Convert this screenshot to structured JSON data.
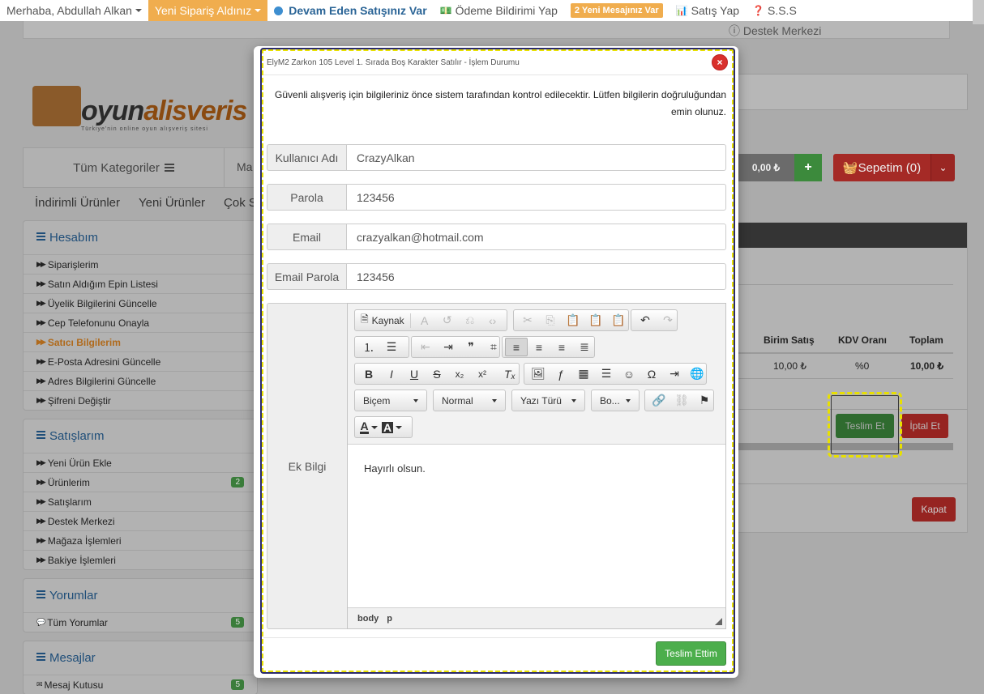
{
  "topbar": {
    "greeting": "Merhaba, Abdullah Alkan",
    "new_order": "Yeni Sipariş Aldınız",
    "ongoing_sale": "Devam Eden Satışınız Var",
    "payment_notice": "Ödeme Bildirimi Yap",
    "messages_badge": "2 Yeni Mesajınız Var",
    "sell": "Satış Yap",
    "faq": "S.S.S",
    "support": "Destek Merkezi"
  },
  "logo": {
    "text_a": "oyun",
    "text_b": "alisveris",
    "tagline": "Türkiye'nin online oyun alışveriş sitesi"
  },
  "nav": {
    "all_categories": "Tüm Kategoriler",
    "partial_link": "Ma",
    "balance": "0,00 ₺",
    "plus": "+",
    "cart": "Sepetim (0)",
    "sub_links": [
      "İndirimli Ürünler",
      "Yeni Ürünler",
      "Çok S"
    ]
  },
  "sidebar": {
    "hesabim": {
      "title": "Hesabım",
      "items": [
        "Siparişlerim",
        "Satın Aldığım Epin Listesi",
        "Üyelik Bilgilerini Güncelle",
        "Cep Telefonunu Onayla",
        "Satıcı Bilgilerim",
        "E-Posta Adresini Güncelle",
        "Adres Bilgilerini Güncelle",
        "Şifreni Değiştir"
      ]
    },
    "satislarim": {
      "title": "Satışlarım",
      "items": [
        "Yeni Ürün Ekle",
        "Ürünlerim",
        "Satışlarım",
        "Destek Merkezi",
        "Mağaza İşlemleri",
        "Bakiye İşlemleri"
      ],
      "products_badge": "2"
    },
    "yorumlar": {
      "title": "Yorumlar",
      "items": [
        "Tüm Yorumlar"
      ],
      "badge": "5"
    },
    "mesajlar": {
      "title": "Mesajlar",
      "items": [
        "Mesaj Kutusu"
      ],
      "badge": "5"
    }
  },
  "order_table": {
    "headers": [
      "Birim Satış",
      "KDV Oranı",
      "Toplam"
    ],
    "row": [
      "10,00 ₺",
      "%0",
      "10,00 ₺"
    ],
    "deliver_btn": "Teslim Et",
    "cancel_btn": "İptal Et",
    "close_btn": "Kapat"
  },
  "modal": {
    "title": "ElyM2 Zarkon 105 Level 1. Sırada Boş Karakter Satılır - İşlem Durumu",
    "close_icon": "×",
    "notice": "Güvenli alışveriş için bilgileriniz önce sistem tarafından kontrol edilecektir. Lütfen bilgilerin doğruluğundan emin olunuz.",
    "fields": {
      "username": {
        "label": "Kullanıcı Adı",
        "value": "CrazyAlkan"
      },
      "password": {
        "label": "Parola",
        "value": "123456"
      },
      "email": {
        "label": "Email",
        "value": "crazyalkan@hotmail.com"
      },
      "email_password": {
        "label": "Email Parola",
        "value": "123456"
      }
    },
    "extra_label": "Ek Bilgi",
    "editor": {
      "source_label": "Kaynak",
      "format_combo": "Biçem",
      "style_combo": "Normal",
      "font_combo": "Yazı Türü",
      "size_combo": "Bo...",
      "content": "Hayırlı olsun.",
      "path_body": "body",
      "path_p": "p"
    },
    "submit": "Teslim Ettim"
  }
}
